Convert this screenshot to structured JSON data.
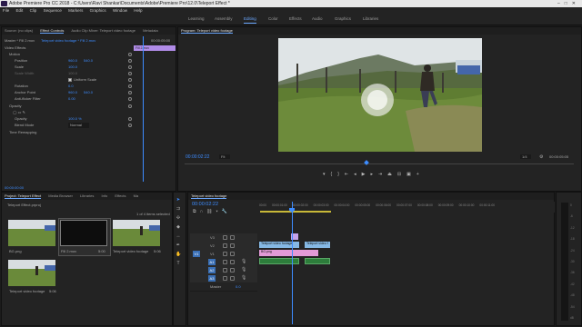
{
  "app": {
    "title": "Adobe Premiere Pro CC 2018 - C:\\Users\\Ravi Shankar\\Documents\\Adobe\\Premiere Pro\\12.0\\Teleport Effect *",
    "window_controls": [
      "–",
      "□",
      "✕"
    ]
  },
  "menu": [
    "File",
    "Edit",
    "Clip",
    "Sequence",
    "Markers",
    "Graphics",
    "Window",
    "Help"
  ],
  "workspaces": [
    "Learning",
    "Assembly",
    "Editing",
    "Color",
    "Effects",
    "Audio",
    "Graphics",
    "Libraries"
  ],
  "active_workspace": "Editing",
  "source_panel": {
    "tabs": [
      "Source: (no clips)",
      "Effect Controls",
      "Audio Clip Mixer: Teleport video footage",
      "Metadata"
    ],
    "master_label": "Master * Fill 2.mov",
    "seq_label": "Teleport video footage * Fill 2.mov",
    "header_time": "00:00:00",
    "header_time2": "00:00:05:00",
    "clip_name": "Fill 2.mov",
    "video_effects_label": "Video Effects",
    "motion_label": "Motion",
    "position_label": "Position",
    "position_x": "960.0",
    "position_y": "540.0",
    "scale_label": "Scale",
    "scale_value": "100.0",
    "scale_width_label": "Scale Width",
    "scale_width_value": "100.0",
    "uniform_scale_label": "Uniform Scale",
    "rotation_label": "Rotation",
    "rotation_value": "0.0",
    "anchor_label": "Anchor Point",
    "anchor_x": "960.0",
    "anchor_y": "540.0",
    "flicker_label": "Anti-flicker Filter",
    "flicker_value": "0.00",
    "opacity_label": "Opacity",
    "opacity_pct_label": "Opacity",
    "opacity_value": "100.0 %",
    "blend_label": "Blend Mode",
    "blend_value": "Normal",
    "time_remap_label": "Time Remapping",
    "footer_time": "00:00:00:00"
  },
  "program": {
    "tab": "Program: Teleport video footage",
    "timecode": "00:00:02:22",
    "fit": "Fit",
    "quality": "1/4",
    "duration": "00:00:05:05",
    "sky": "#d9dfe2",
    "grass": "#5f7d32"
  },
  "project": {
    "tabs": [
      "Project: Teleport Effect",
      "Media Browser",
      "Libraries",
      "Info",
      "Effects",
      "Ma"
    ],
    "file": "Teleport Effect.prproj",
    "selection": "1 of 4 items selected",
    "items": [
      {
        "name": "BG.png",
        "duration": ""
      },
      {
        "name": "Fill 2.mov",
        "duration": "5:00"
      },
      {
        "name": "Teleport video footage",
        "duration": "5:06"
      },
      {
        "name": "Teleport video footage",
        "duration": "5:06"
      }
    ]
  },
  "timeline": {
    "tab": "Teleport video footage",
    "timecode": "00:00:02:22",
    "ruler": [
      "00:00",
      "00:00:01:00",
      "00:00:02:00",
      "00:00:03:00",
      "00:00:04:00",
      "00:00:05:00",
      "00:00:06:00",
      "00:00:07:00",
      "00:00:08:00",
      "00:00:09:00",
      "00:00:10:00",
      "00:00:11:00"
    ],
    "video_tracks": [
      "V3",
      "V2",
      "V1"
    ],
    "audio_tracks": [
      "A1",
      "A2",
      "A3"
    ],
    "master_label": "Master",
    "master_value": "0.0",
    "clips": {
      "fill": "",
      "video_a": "Teleport video footage",
      "video_b": "Teleport video f",
      "bg": "BG.png"
    },
    "meter_labels": [
      "0",
      "-6",
      "-12",
      "-18",
      "-24",
      "-30",
      "-36",
      "-42",
      "-48",
      "-54",
      "dB"
    ]
  },
  "colors": {
    "accent": "#3d8cff",
    "clip_video": "#85b8e4",
    "clip_pink": "#e39ad8",
    "clip_purple": "#b18ce8",
    "clip_audio": "#2d7d3b"
  }
}
